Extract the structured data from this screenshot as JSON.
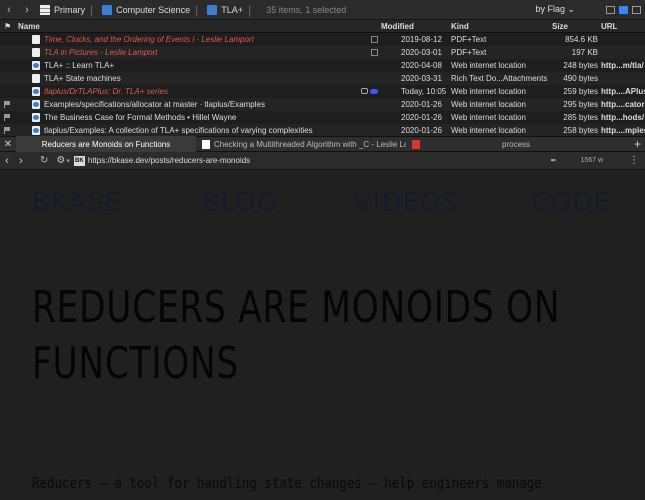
{
  "toolbar": {
    "crumbs": [
      "Primary",
      "Computer Science",
      "TLA+"
    ],
    "count": "35 items, 1 selected",
    "sort": "by Flag"
  },
  "columns": {
    "name": "Name",
    "modified": "Modified",
    "kind": "Kind",
    "size": "Size",
    "url": "URL"
  },
  "rows": [
    {
      "name": "Time, Clocks, and the Ordering of Events i - Leslie Lamport",
      "modified": "2019-08-12",
      "kind": "PDF+Text",
      "size": "854.6 KB",
      "url": ""
    },
    {
      "name": "TLA in Pictures - Leslie Lamport",
      "modified": "2020-03-01",
      "kind": "PDF+Text",
      "size": "197 KB",
      "url": ""
    },
    {
      "name": "TLA+ :: Learn TLA+",
      "modified": "2020-04-08",
      "kind": "Web internet location",
      "size": "248 bytes",
      "url": "http...m/tla/"
    },
    {
      "name": "TLA+ State machines",
      "modified": "2020-03-31",
      "kind": "Rich Text Do...Attachments",
      "size": "490 bytes",
      "url": ""
    },
    {
      "name": "tlaplus/DrTLAPlus: Dr. TLA+ series",
      "modified": "Today, 10:05",
      "kind": "Web internet location",
      "size": "259 bytes",
      "url": "http....APlus"
    },
    {
      "name": "Examples/specifications/allocator at master · tlaplus/Examples",
      "modified": "2020-01-26",
      "kind": "Web internet location",
      "size": "295 bytes",
      "url": "http....cator"
    },
    {
      "name": "The Business Case for Formal Methods • Hillel Wayne",
      "modified": "2020-01-26",
      "kind": "Web internet location",
      "size": "285 bytes",
      "url": "http...hods/"
    },
    {
      "name": "tlaplus/Examples: A collection of TLA+ specifications of varying complexities",
      "modified": "2020-01-26",
      "kind": "Web internet location",
      "size": "258 bytes",
      "url": "http....mples"
    }
  ],
  "tabs": [
    {
      "label": "Reducers are Monoids on Functions"
    },
    {
      "label": "Checking a Multithreaded Algorithm with _C - Leslie Lam..."
    },
    {
      "label": ""
    },
    {
      "label": "process"
    }
  ],
  "address": {
    "url": "https://bkase.dev/posts/reducers-are-monoids",
    "favicon": "BK",
    "word_count": "1567 w"
  },
  "page": {
    "nav": [
      "BKASE",
      "BLOG",
      "VIDEOS",
      "CODE"
    ],
    "title": "REDUCERS ARE MONOIDS ON FUNCTIONS",
    "lead": "Reducers — a tool for handling state changes — help engineers manage"
  }
}
